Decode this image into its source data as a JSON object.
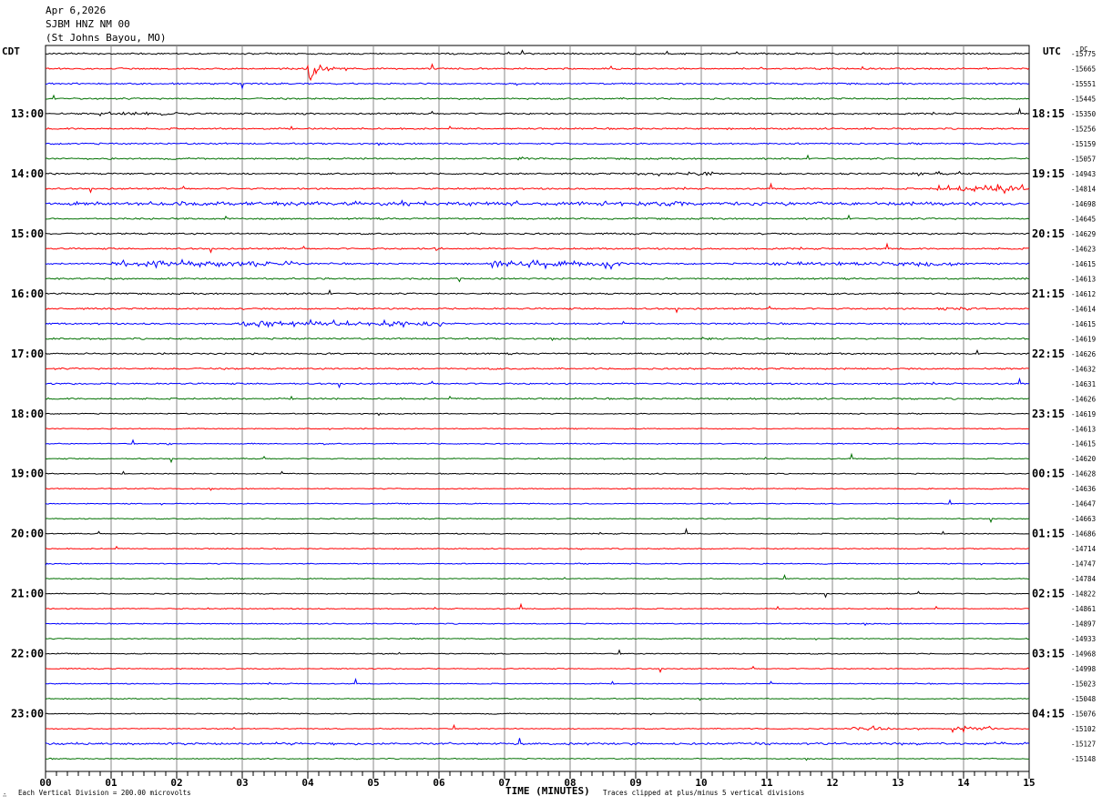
{
  "header": {
    "date": "Apr 6,2026",
    "station": "SJBM HNZ NM 00",
    "location": "(St Johns Bayou, MO)"
  },
  "chart_data": {
    "type": "line",
    "title": "SJBM HNZ NM 00",
    "left_axis_label": "CDT",
    "right_axis_label": "UTC",
    "dc_label": "DC",
    "xlabel": "TIME (MINUTES)",
    "x_ticks": [
      "00",
      "01",
      "02",
      "03",
      "04",
      "05",
      "06",
      "07",
      "08",
      "09",
      "10",
      "11",
      "12",
      "13",
      "14",
      "15"
    ],
    "xlim": [
      0,
      15
    ],
    "grid": true,
    "trace_colors": [
      "#000000",
      "#ff0000",
      "#0000ff",
      "#007000"
    ],
    "left_time_labels": [
      "13:00",
      "14:00",
      "15:00",
      "16:00",
      "17:00",
      "18:00",
      "19:00",
      "20:00",
      "21:00",
      "22:00",
      "23:00"
    ],
    "right_time_labels": [
      "18:15",
      "19:15",
      "20:15",
      "21:15",
      "22:15",
      "23:15",
      "00:15",
      "01:15",
      "02:15",
      "03:15",
      "04:15"
    ],
    "dc_offsets": [
      "-15775",
      "-15665",
      "-15551",
      "-15445",
      "-15350",
      "-15256",
      "-15159",
      "-15057",
      "-14943",
      "-14814",
      "-14698",
      "-14645",
      "-14629",
      "-14623",
      "-14615",
      "-14613",
      "-14612",
      "-14614",
      "-14615",
      "-14619",
      "-14626",
      "-14632",
      "-14631",
      "-14626",
      "-14619",
      "-14613",
      "-14615",
      "-14620",
      "-14628",
      "-14636",
      "-14647",
      "-14663",
      "-14686",
      "-14714",
      "-14747",
      "-14784",
      "-14822",
      "-14861",
      "-14897",
      "-14933",
      "-14968",
      "-14998",
      "-15023",
      "-15048",
      "-15076",
      "-15102",
      "-15127",
      "-15148"
    ],
    "events": [
      {
        "trace": 1,
        "minute": 4.0,
        "amplitude_div": 5,
        "duration_min": 0.4
      },
      {
        "trace": 4,
        "minute": 0.8,
        "amplitude_div": 0.6,
        "duration_min": 1.2
      },
      {
        "trace": 4,
        "minute": 3.8,
        "amplitude_div": 0.5,
        "duration_min": 0.4
      },
      {
        "trace": 7,
        "minute": 7.2,
        "amplitude_div": 0.5,
        "duration_min": 0.2
      },
      {
        "trace": 8,
        "minute": 9.0,
        "amplitude_div": 0.6,
        "duration_min": 1.2
      },
      {
        "trace": 8,
        "minute": 13.2,
        "amplitude_div": 0.5,
        "duration_min": 0.6
      },
      {
        "trace": 9,
        "minute": 13.6,
        "amplitude_div": 1.2,
        "duration_min": 1.4
      },
      {
        "trace": 10,
        "minute": 0.2,
        "amplitude_div": 0.5,
        "duration_min": 14.6
      },
      {
        "trace": 13,
        "minute": 5.9,
        "amplitude_div": 1.0,
        "duration_min": 0.2
      },
      {
        "trace": 14,
        "minute": 1.0,
        "amplitude_div": 1.0,
        "duration_min": 3.0
      },
      {
        "trace": 14,
        "minute": 6.8,
        "amplitude_div": 1.3,
        "duration_min": 2.0
      },
      {
        "trace": 14,
        "minute": 11.0,
        "amplitude_div": 0.6,
        "duration_min": 3.0
      },
      {
        "trace": 17,
        "minute": 13.6,
        "amplitude_div": 0.6,
        "duration_min": 0.6
      },
      {
        "trace": 18,
        "minute": 2.9,
        "amplitude_div": 0.9,
        "duration_min": 3.2
      },
      {
        "trace": 19,
        "minute": 10.0,
        "amplitude_div": 0.6,
        "duration_min": 0.4
      },
      {
        "trace": 26,
        "minute": 1.85,
        "amplitude_div": 0.8,
        "duration_min": 0.1
      },
      {
        "trace": 45,
        "minute": 12.3,
        "amplitude_div": 0.8,
        "duration_min": 0.6
      },
      {
        "trace": 45,
        "minute": 13.8,
        "amplitude_div": 1.0,
        "duration_min": 0.7
      },
      {
        "trace": 46,
        "minute": 0.0,
        "amplitude_div": 0.3,
        "duration_min": 15
      }
    ]
  },
  "footer": {
    "scale_note": "Each Vertical Division =  200.00 microvolts",
    "clip_note": "Traces clipped at plus/minus 5 vertical divisions",
    "logo_mark": "∴"
  }
}
